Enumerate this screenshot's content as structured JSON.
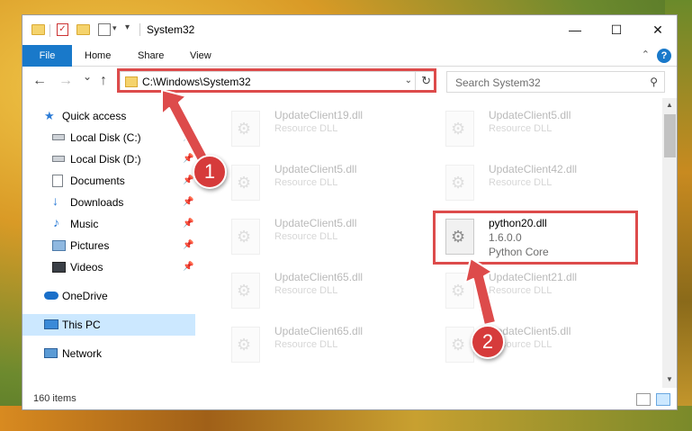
{
  "window": {
    "title": "System32",
    "minimize_glyph": "—",
    "maximize_glyph": "☐",
    "close_glyph": "✕"
  },
  "ribbon": {
    "tabs": [
      {
        "label": "File",
        "active": true
      },
      {
        "label": "Home"
      },
      {
        "label": "Share"
      },
      {
        "label": "View"
      }
    ],
    "help_glyph": "?",
    "collapse_glyph": "⌃"
  },
  "navigation": {
    "back_glyph": "←",
    "forward_glyph": "→",
    "recent_glyph": "⌄",
    "up_glyph": "↑"
  },
  "address_bar": {
    "path": "C:\\Windows\\System32",
    "dropdown_glyph": "⌄",
    "refresh_glyph": "↻"
  },
  "search": {
    "placeholder": "Search System32",
    "icon_glyph": "⚲"
  },
  "nav_pane": {
    "items": [
      {
        "label": "Quick access",
        "icon": "star-icon",
        "pinned": false
      },
      {
        "label": "Local Disk (C:)",
        "icon": "drive-icon",
        "pinned": true
      },
      {
        "label": "Local Disk (D:)",
        "icon": "drive-icon",
        "pinned": true
      },
      {
        "label": "Documents",
        "icon": "documents-icon",
        "pinned": true
      },
      {
        "label": "Downloads",
        "icon": "download-icon",
        "pinned": true
      },
      {
        "label": "Music",
        "icon": "music-icon",
        "pinned": true
      },
      {
        "label": "Pictures",
        "icon": "pictures-icon",
        "pinned": true
      },
      {
        "label": "Videos",
        "icon": "videos-icon",
        "pinned": true
      },
      {
        "label": "OneDrive",
        "icon": "cloud-icon",
        "pinned": false
      },
      {
        "label": "This PC",
        "icon": "computer-icon",
        "pinned": false,
        "selected": true
      },
      {
        "label": "Network",
        "icon": "network-icon",
        "pinned": false
      }
    ],
    "pin_glyph": "📌"
  },
  "files": [
    {
      "name": "UpdateClient19.dll",
      "desc": "Resource DLL",
      "faded": true
    },
    {
      "name": "UpdateClient5.dll",
      "desc": "Resource DLL",
      "faded": true
    },
    {
      "name": "UpdateClient5.dll",
      "desc": "Resource DLL",
      "faded": true
    },
    {
      "name": "UpdateClient42.dll",
      "desc": "Resource DLL",
      "faded": true
    },
    {
      "name": "UpdateClient5.dll",
      "desc": "Resource DLL",
      "faded": true
    },
    {
      "name": "python20.dll",
      "version": "1.6.0.0",
      "desc": "Python Core",
      "faded": false,
      "highlighted": true
    },
    {
      "name": "UpdateClient65.dll",
      "desc": "Resource DLL",
      "faded": true
    },
    {
      "name": "UpdateClient21.dll",
      "desc": "Resource DLL",
      "faded": true
    },
    {
      "name": "UpdateClient65.dll",
      "desc": "Resource DLL",
      "faded": true
    },
    {
      "name": "UpdateClient5.dll",
      "desc": "Resource DLL",
      "faded": true
    }
  ],
  "status_bar": {
    "item_count": "160 items"
  },
  "annotations": [
    {
      "label": "1",
      "target": "address-bar"
    },
    {
      "label": "2",
      "target": "python20-dll"
    }
  ],
  "colors": {
    "accent": "#1979ca",
    "highlight": "#dd4b4b",
    "selected_bg": "#cce8ff"
  }
}
